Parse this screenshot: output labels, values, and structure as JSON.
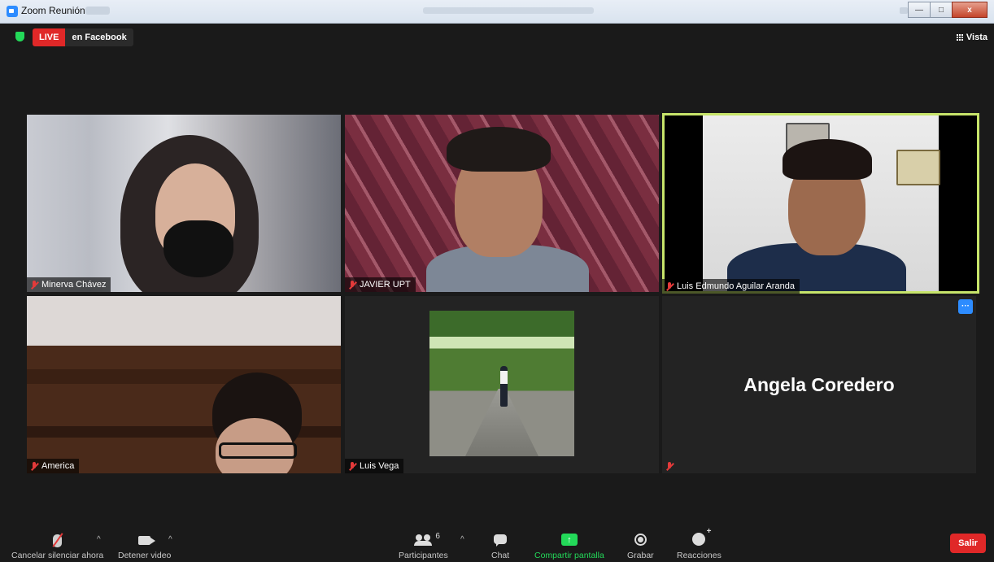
{
  "window": {
    "title": "Zoom Reunión",
    "controls": {
      "minimize": "—",
      "maximize": "□",
      "close": "x"
    }
  },
  "topbar": {
    "live_label": "LIVE",
    "live_destination": "en Facebook",
    "view_label": "Vista"
  },
  "participants": [
    {
      "name": "Minerva Chávez",
      "muted": true
    },
    {
      "name": "JAVIER UPT",
      "muted": true
    },
    {
      "name": "Luis Edmundo Aguilar Aranda",
      "muted": true,
      "active_speaker": true
    },
    {
      "name": "America",
      "muted": true
    },
    {
      "name": "Luis Vega",
      "muted": true
    },
    {
      "name": "",
      "display_name": "Angela Coredero",
      "muted": true,
      "more_label": "···"
    }
  ],
  "toolbar": {
    "mute_label": "Cancelar silenciar ahora",
    "caret": "^",
    "video_label": "Detener video",
    "participants_label": "Participantes",
    "participants_count": "6",
    "chat_label": "Chat",
    "share_label": "Compartir pantalla",
    "share_arrow": "↑",
    "record_label": "Grabar",
    "reactions_label": "Reacciones",
    "leave_label": "Salir"
  },
  "colors": {
    "background": "#1a1a1a",
    "live_red": "#e02828",
    "share_green": "#23d959",
    "speaker_highlight": "#c7e46a",
    "zoom_blue": "#2d8cff"
  }
}
